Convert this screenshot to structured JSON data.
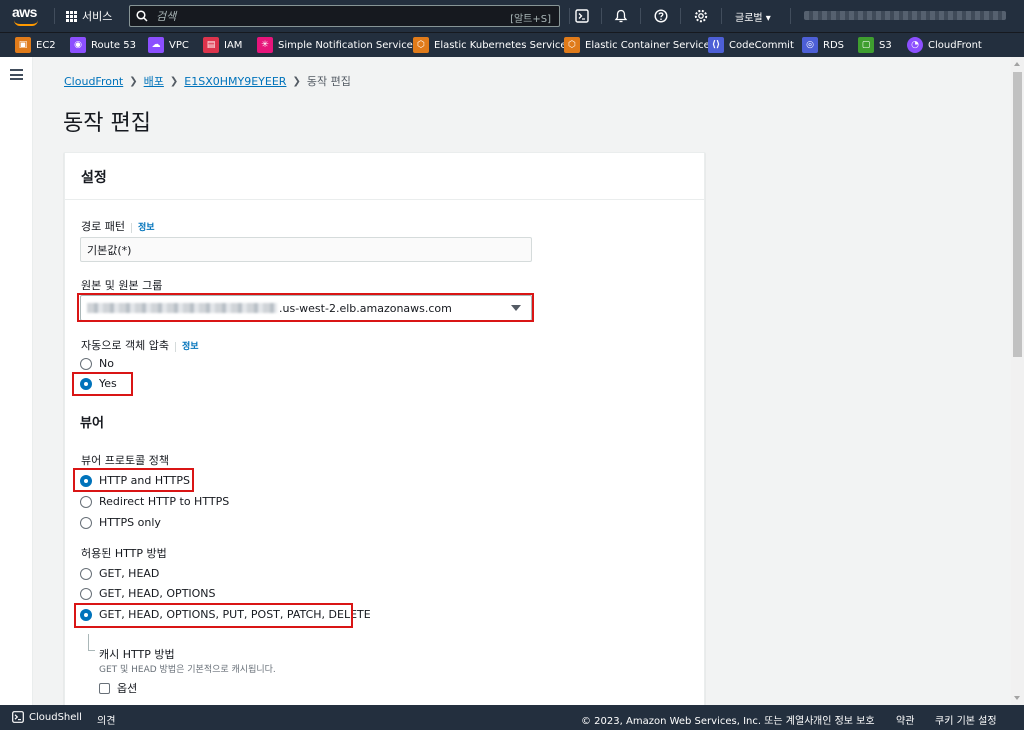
{
  "topbar": {
    "logo_text": "aws",
    "services_label": "서비스",
    "search_placeholder": "검색",
    "search_shortcut": "[알트+S]",
    "region_label": "글로벌 ▾",
    "icons": [
      "cloudshell-icon",
      "bell-icon",
      "help-icon",
      "gear-icon"
    ]
  },
  "favorites": [
    {
      "label": "EC2",
      "icon": "ec2-icon",
      "color": "#e07b1a"
    },
    {
      "label": "Route 53",
      "icon": "route53-icon",
      "color": "#8c4fff"
    },
    {
      "label": "VPC",
      "icon": "vpc-icon",
      "color": "#8c4fff"
    },
    {
      "label": "IAM",
      "icon": "iam-icon",
      "color": "#dd344c"
    },
    {
      "label": "Simple Notification Service",
      "icon": "sns-icon",
      "color": "#e7157b"
    },
    {
      "label": "Elastic Kubernetes Service",
      "icon": "eks-icon",
      "color": "#e07b1a"
    },
    {
      "label": "Elastic Container Service",
      "icon": "ecs-icon",
      "color": "#e07b1a"
    },
    {
      "label": "CodeCommit",
      "icon": "codecommit-icon",
      "color": "#4d5fd6"
    },
    {
      "label": "RDS",
      "icon": "rds-icon",
      "color": "#4d5fd6"
    },
    {
      "label": "S3",
      "icon": "s3-icon",
      "color": "#3f9e2f"
    },
    {
      "label": "CloudFront",
      "icon": "cloudfront-icon",
      "color": "#8c4fff"
    }
  ],
  "breadcrumb": {
    "items": [
      "CloudFront",
      "배포",
      "E1SX0HMY9EYEER"
    ],
    "current": "동작 편집"
  },
  "page_title": "동작 편집",
  "settings": {
    "header": "설정",
    "path_pattern": {
      "label": "경로 패턴",
      "info": "정보",
      "value": "기본값(*)"
    },
    "origin": {
      "label": "원본 및 원본 그룹",
      "value_suffix": ".us-west-2.elb.amazonaws.com"
    },
    "compress": {
      "label": "자동으로 객체 압축",
      "info": "정보",
      "options": [
        "No",
        "Yes"
      ],
      "selected": "Yes"
    },
    "viewer": {
      "header": "뷰어",
      "protocol_label": "뷰어 프로토콜 정책",
      "protocol_options": [
        "HTTP and HTTPS",
        "Redirect HTTP to HTTPS",
        "HTTPS only"
      ],
      "protocol_selected": "HTTP and HTTPS",
      "methods_label": "허용된 HTTP 방법",
      "methods_options": [
        "GET, HEAD",
        "GET, HEAD, OPTIONS",
        "GET, HEAD, OPTIONS, PUT, POST, PATCH, DELETE"
      ],
      "methods_selected": "GET, HEAD, OPTIONS, PUT, POST, PATCH, DELETE",
      "cache_label": "캐시 HTTP 방법",
      "cache_note": "GET 및 HEAD 방법은 기본적으로 캐시됩니다.",
      "cache_option": "옵션"
    }
  },
  "footer": {
    "cloudshell": "CloudShell",
    "feedback": "의견",
    "copyright": "© 2023, Amazon Web Services, Inc. 또는 계열사.",
    "privacy": "개인 정보 보호",
    "terms": "약관",
    "cookies": "쿠키 기본 설정"
  },
  "colors": {
    "nav_bg": "#232f3e",
    "accent": "#0073bb",
    "highlight": "#d91515",
    "page_bg": "#f2f3f3"
  }
}
